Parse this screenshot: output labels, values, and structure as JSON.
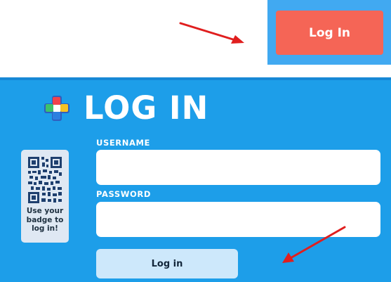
{
  "top": {
    "login_button_label": "Log In"
  },
  "panel": {
    "title": "LOG IN",
    "username_label": "USERNAME",
    "password_label": "PASSWORD",
    "badge_caption": "Use your badge to log in!",
    "submit_label": "Log in"
  },
  "colors": {
    "panel_bg": "#1d9ee9",
    "top_strip_bg": "#41a9f1",
    "top_button_bg": "#f56556",
    "submit_bg": "#cde8fb",
    "annotation_arrow": "#e01e1e"
  },
  "icons": {
    "logo": "colorful-plus-logo-icon",
    "badge": "qr-code-icon",
    "annotations": "red-arrow-icon"
  }
}
